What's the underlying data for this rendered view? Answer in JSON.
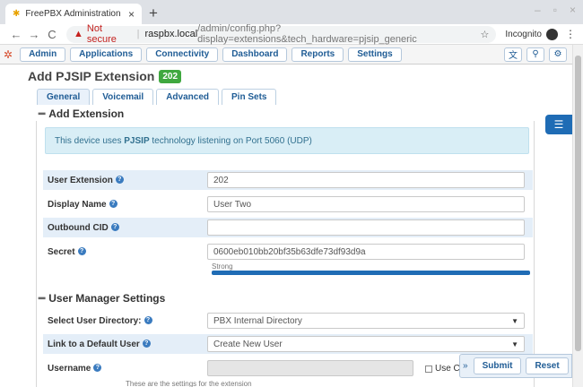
{
  "browser": {
    "tab_title": "FreePBX Administration",
    "url_warning": "Not secure",
    "url_host": "raspbx.local",
    "url_path": "/admin/config.php?display=extensions&tech_hardware=pjsip_generic",
    "incognito_label": "Incognito"
  },
  "nav": {
    "items": [
      "Admin",
      "Applications",
      "Connectivity",
      "Dashboard",
      "Reports",
      "Settings"
    ]
  },
  "page": {
    "title": "Add PJSIP Extension",
    "extension_badge": "202"
  },
  "tabs": [
    "General",
    "Voicemail",
    "Advanced",
    "Pin Sets"
  ],
  "add_extension": {
    "heading": "Add Extension",
    "alert_prefix": "This device uses",
    "alert_tech": "PJSIP",
    "alert_suffix": "technology listening on Port 5060 (UDP)",
    "fields": {
      "user_extension": {
        "label": "User Extension",
        "value": "202"
      },
      "display_name": {
        "label": "Display Name",
        "value": "User Two"
      },
      "outbound_cid": {
        "label": "Outbound CID",
        "value": ""
      },
      "secret": {
        "label": "Secret",
        "value": "0600eb010bb20bf35b63dfe73df93d9a",
        "strength": "Strong"
      }
    }
  },
  "user_manager": {
    "heading": "User Manager Settings",
    "fields": {
      "select_user_directory": {
        "label": "Select User Directory:",
        "value": "PBX Internal Directory"
      },
      "link_default_user": {
        "label": "Link to a Default User",
        "value": "Create New User"
      },
      "username": {
        "label": "Username",
        "value": "",
        "use_custom_label": "Use Cu"
      }
    }
  },
  "actions": {
    "submit": "Submit",
    "reset": "Reset"
  },
  "status_hint": "These are the settings for the extension"
}
